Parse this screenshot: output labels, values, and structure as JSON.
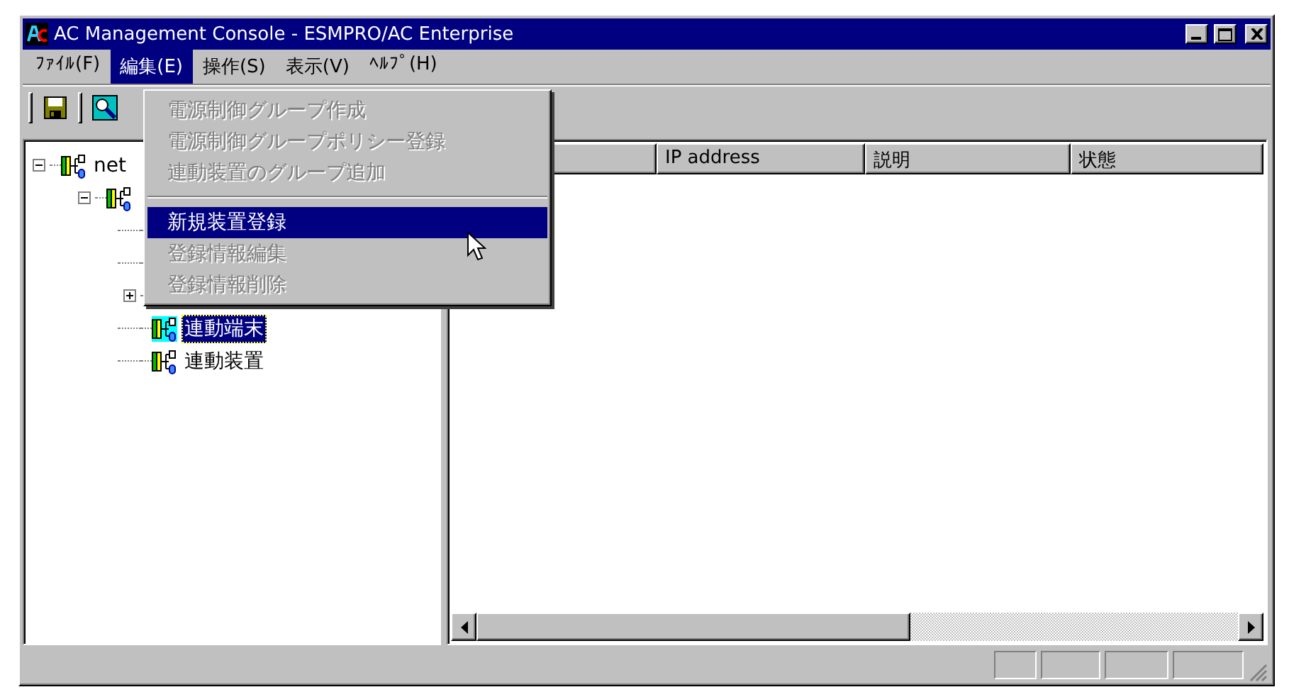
{
  "window": {
    "title": "AC Management Console - ESMPRO/AC Enterprise"
  },
  "menu_bar": [
    {
      "label": "ﾌｧｲﾙ(F)",
      "selected": false
    },
    {
      "label": "編集(E)",
      "selected": true
    },
    {
      "label": "操作(S)",
      "selected": false
    },
    {
      "label": "表示(V)",
      "selected": false
    },
    {
      "label": "ﾍﾙﾌﾟ(H)",
      "selected": false
    }
  ],
  "edit_menu": [
    {
      "kind": "item",
      "label": "電源制御グループ作成",
      "disabled": true,
      "selected": false
    },
    {
      "kind": "item",
      "label": "電源制御グループポリシー登録",
      "disabled": true,
      "selected": false
    },
    {
      "kind": "item",
      "label": "連動装置のグループ追加",
      "disabled": true,
      "selected": false
    },
    {
      "kind": "separator"
    },
    {
      "kind": "item",
      "label": "新規装置登録",
      "disabled": false,
      "selected": true
    },
    {
      "kind": "item",
      "label": "登録情報編集",
      "disabled": true,
      "selected": false
    },
    {
      "kind": "item",
      "label": "登録情報削除",
      "disabled": true,
      "selected": false
    }
  ],
  "tree": [
    {
      "label": "net",
      "selected": false,
      "expanded": true,
      "children": [
        {
          "selected": false,
          "expanded": true,
          "children": [
            {
              "kind": "stub"
            },
            {
              "kind": "stub"
            },
            {
              "kind": "stub",
              "expanded": false
            },
            {
              "kind": "node",
              "label": "連動端末",
              "selected": true
            },
            {
              "kind": "node",
              "label": "連動装置",
              "selected": false
            }
          ]
        }
      ]
    }
  ],
  "list": {
    "columns": [
      {
        "label": "IP address"
      },
      {
        "label": "説明"
      },
      {
        "label": "状態"
      }
    ]
  }
}
